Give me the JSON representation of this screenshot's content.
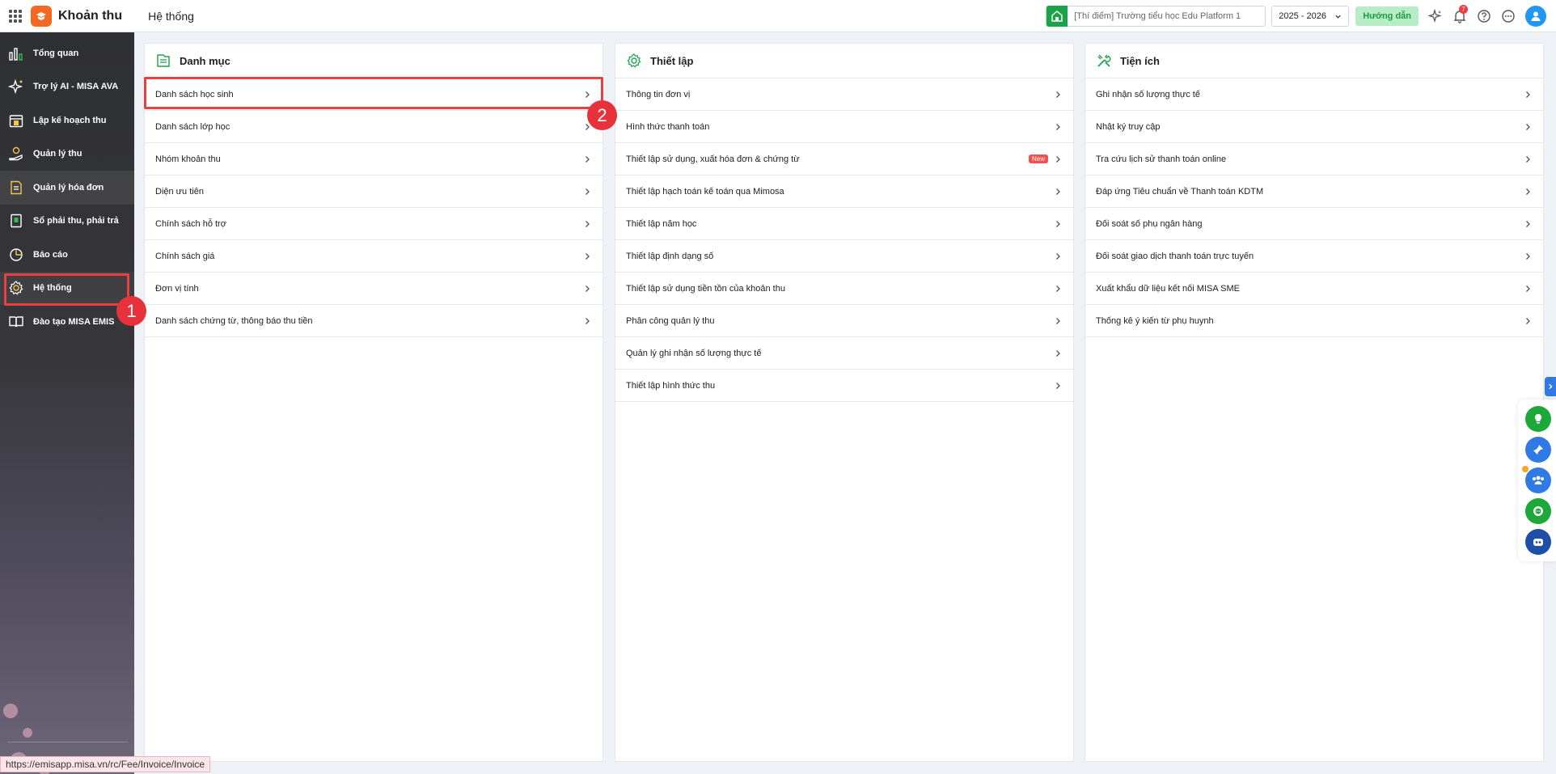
{
  "header": {
    "app_name": "Khoản thu",
    "page_title": "Hệ thống",
    "school": "[Thí điểm] Trường tiểu học Edu Platform 1",
    "year": "2025 - 2026",
    "guide_label": "Hướng dẫn",
    "notif_count": "7"
  },
  "sidebar": {
    "items": [
      {
        "label": "Tổng quan",
        "icon": "chart-bar-icon"
      },
      {
        "label": "Trợ lý AI - MISA AVA",
        "icon": "sparkle-icon"
      },
      {
        "label": "Lập kế hoạch thu",
        "icon": "calendar-money-icon"
      },
      {
        "label": "Quản lý thu",
        "icon": "money-hand-icon"
      },
      {
        "label": "Quản lý hóa đơn",
        "icon": "invoice-icon"
      },
      {
        "label": "Sổ phải thu, phải trả",
        "icon": "ledger-icon"
      },
      {
        "label": "Báo cáo",
        "icon": "pie-chart-icon"
      },
      {
        "label": "Hệ thống",
        "icon": "gear-icon"
      },
      {
        "label": "Đào tạo MISA EMIS",
        "icon": "book-icon"
      }
    ]
  },
  "annotations": {
    "step1": "1",
    "step2": "2"
  },
  "columns": {
    "danh_muc": {
      "title": "Danh mục",
      "items": [
        "Danh sách học sinh",
        "Danh sách lớp học",
        "Nhóm khoản thu",
        "Diện ưu tiên",
        "Chính sách hỗ trợ",
        "Chính sách giá",
        "Đơn vị tính",
        "Danh sách chứng từ, thông báo thu tiền"
      ]
    },
    "thiet_lap": {
      "title": "Thiết lập",
      "new_badge": "New",
      "items": [
        "Thông tin đơn vị",
        "Hình thức thanh toán",
        "Thiết lập sử dụng, xuất hóa đơn & chứng từ",
        "Thiết lập hạch toán kế toán qua Mimosa",
        "Thiết lập năm học",
        "Thiết lập định dạng số",
        "Thiết lập sử dụng tiền tồn của khoản thu",
        "Phân công quản lý thu",
        "Quản lý ghi nhận số lượng thực tế",
        "Thiết lập hình thức thu"
      ]
    },
    "tien_ich": {
      "title": "Tiện ích",
      "items": [
        "Ghi nhận số lượng thực tế",
        "Nhật ký truy cập",
        "Tra cứu lịch sử thanh toán online",
        "Đáp ứng Tiêu chuẩn về Thanh toán KDTM",
        "Đối soát số phụ ngân hàng",
        "Đối soát giao dịch thanh toán trực tuyến",
        "Xuất khẩu dữ liệu kết nối MISA SME",
        "Thống kê ý kiến từ phụ huynh"
      ]
    }
  },
  "status_url": "https://emisapp.misa.vn/rc/Fee/Invoice/Invoice",
  "colors": {
    "accent_red": "#e84142",
    "brand_orange": "#f26a21",
    "green": "#1aa34a"
  }
}
